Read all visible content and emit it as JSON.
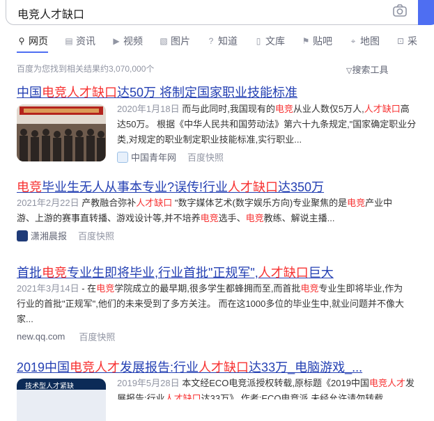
{
  "search": {
    "query": "电竞人才缺口"
  },
  "tabs": [
    {
      "label": "网页",
      "icon": "search-icon",
      "glyph": "⚲"
    },
    {
      "label": "资讯",
      "icon": "news-icon",
      "glyph": "▤"
    },
    {
      "label": "视频",
      "icon": "video-icon",
      "glyph": "▶"
    },
    {
      "label": "图片",
      "icon": "image-icon",
      "glyph": "▧"
    },
    {
      "label": "知道",
      "icon": "question-icon",
      "glyph": "?"
    },
    {
      "label": "文库",
      "icon": "document-icon",
      "glyph": "▯"
    },
    {
      "label": "贴吧",
      "icon": "tieba-icon",
      "glyph": "⚑"
    },
    {
      "label": "地图",
      "icon": "map-pin-icon",
      "glyph": "⌖"
    },
    {
      "label": "采",
      "icon": "cart-icon",
      "glyph": "⊡"
    }
  ],
  "stats": "百度为您找到相关结果约3,070,000个",
  "tools_label": "搜索工具",
  "results": [
    {
      "title_parts": [
        "中国",
        "电竞人才缺口",
        "达50万 将制定国家职业技能标准"
      ],
      "date": "2020年1月18日",
      "snippet_parts": [
        " 而与此同时,我国现有的",
        "电竞",
        "从业人数仅5万人,",
        "人才缺口",
        "高达50万。 根据《中华人民共和国劳动法》第六十九条规定,\"国家确定职业分类,对规定的职业制定职业技能标准,实行职业..."
      ],
      "source": "中国青年网",
      "kuaizhao": "百度快照"
    },
    {
      "title_parts": [
        "",
        "电竞",
        "毕业生无人从事本专业?误传!行业",
        "人才缺口",
        "达350万"
      ],
      "date": "2021年2月22日",
      "snippet_parts": [
        " 产教融合弥补",
        "人才缺口",
        " \"数字媒体艺术(数字娱乐方向)专业聚焦的是",
        "电竞",
        "产业中游、上游的赛事直转播、游戏设计等,并不培养",
        "电竞",
        "选手、",
        "电竞",
        "教练、解说主播..."
      ],
      "source": "潇湘晨报",
      "kuaizhao": "百度快照"
    },
    {
      "title_parts": [
        "首批",
        "电竞",
        "专业生即将毕业,行业首批\"正规军\",",
        "人才缺口",
        "巨大"
      ],
      "date": "2021年3月14日",
      "snippet_parts": [
        " - 在",
        "电竞",
        "学院成立的最早期,很多学生都蜂拥而至,而首批",
        "电竞",
        "专业生即将毕业,作为行业的首批\"正规军\",他们的未来受到了多方关注。 而在这1000多位的毕业生中,就业问题并不像大家..."
      ],
      "source": "new.qq.com",
      "kuaizhao": "百度快照"
    },
    {
      "title_parts": [
        "2019中国",
        "电竞人才",
        "发展报告:行业",
        "人才缺口",
        "达33万_电脑游戏_..."
      ],
      "date": "2019年5月28日",
      "snippet_parts": [
        " 本文经ECO电竞派授权转载,原标题《2019中国",
        "电竞人才",
        "发展报告:行业",
        "人才缺口",
        "达33万》 作者:ECO电竞派 未经允许请勿转载"
      ],
      "thumb_caption": "技术型人才紧缺"
    }
  ],
  "colors": {
    "link": "#2440b3",
    "highlight": "#f73131",
    "accent": "#4e6ef2"
  }
}
